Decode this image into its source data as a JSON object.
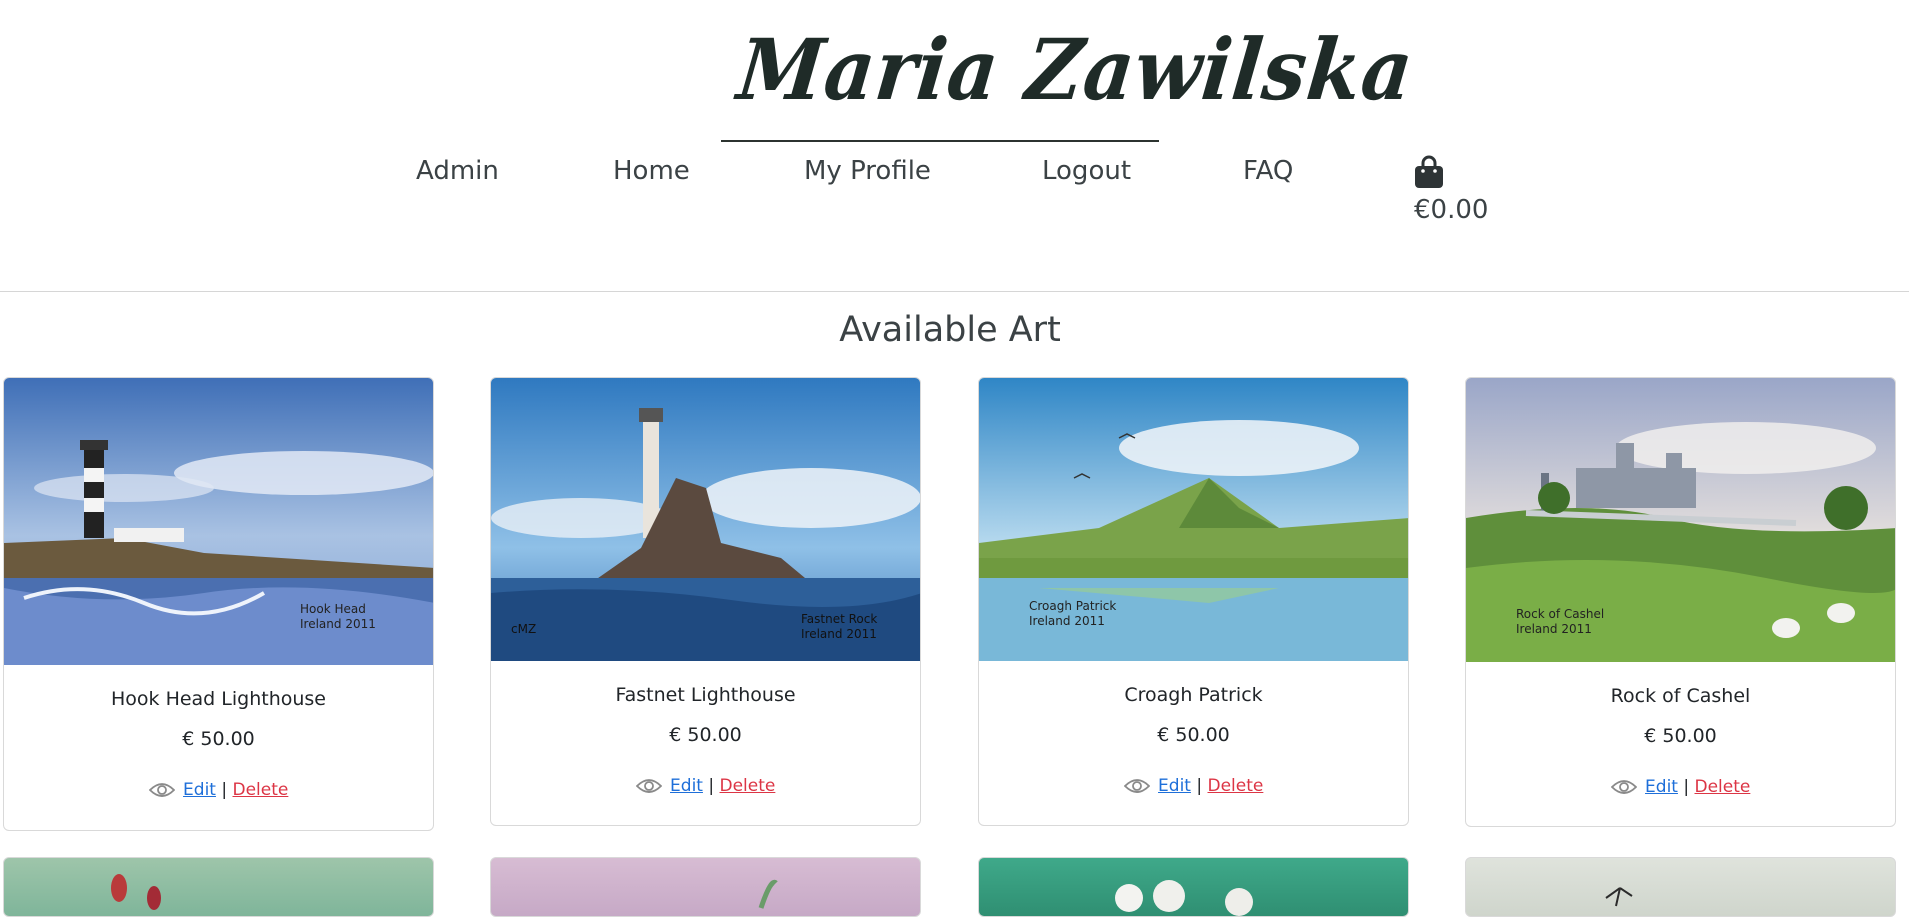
{
  "brand": {
    "logo_text": "Maria Zawilska"
  },
  "nav": {
    "items": [
      {
        "label": "Admin"
      },
      {
        "label": "Home"
      },
      {
        "label": "My Profile"
      },
      {
        "label": "Logout"
      },
      {
        "label": "FAQ"
      }
    ],
    "cart_icon": "shopping-bag-icon",
    "cart_total": "€0.00"
  },
  "main": {
    "heading": "Available Art",
    "products": [
      {
        "title": "Hook Head Lighthouse",
        "price": "€ 50.00",
        "view_icon": "eye-icon",
        "edit_label": "Edit",
        "separator": "|",
        "delete_label": "Delete"
      },
      {
        "title": "Fastnet Lighthouse",
        "price": "€ 50.00",
        "view_icon": "eye-icon",
        "edit_label": "Edit",
        "separator": "|",
        "delete_label": "Delete"
      },
      {
        "title": "Croagh Patrick",
        "price": "€ 50.00",
        "view_icon": "eye-icon",
        "edit_label": "Edit",
        "separator": "|",
        "delete_label": "Delete"
      },
      {
        "title": "Rock of Cashel",
        "price": "€ 50.00",
        "view_icon": "eye-icon",
        "edit_label": "Edit",
        "separator": "|",
        "delete_label": "Delete"
      }
    ]
  },
  "colors": {
    "edit": "#1e6fd9",
    "delete": "#dc3545",
    "text": "#3b4245"
  }
}
